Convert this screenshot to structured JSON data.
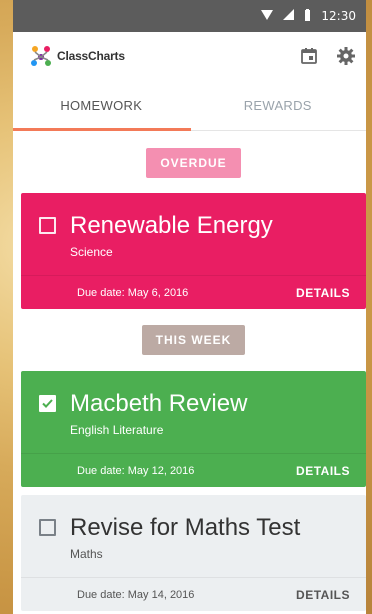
{
  "status_bar": {
    "time": "12:30"
  },
  "app": {
    "logo_text": "ClassCharts"
  },
  "tabs": [
    {
      "label": "HOMEWORK",
      "active": true
    },
    {
      "label": "REWARDS",
      "active": false
    }
  ],
  "sections": {
    "overdue": {
      "label": "OVERDUE"
    },
    "this_week": {
      "label": "THIS WEEK"
    }
  },
  "cards": [
    {
      "title": "Renewable Energy",
      "subject": "Science",
      "due": "Due date: May 6, 2016",
      "details": "DETAILS",
      "checked": false,
      "color": "#e91e63"
    },
    {
      "title": "Macbeth Review",
      "subject": "English Literature",
      "due": "Due date: May 12, 2016",
      "details": "DETAILS",
      "checked": true,
      "color": "#4caf50"
    },
    {
      "title": "Revise for Maths Test",
      "subject": "Maths",
      "due": "Due date: May 14, 2016",
      "details": "DETAILS",
      "checked": false,
      "color": "#eceff1"
    }
  ],
  "colors": {
    "accent": "#f37a58",
    "overdue_pill": "#f48fb1",
    "this_week_pill": "#bcaaa4",
    "status_bar": "#5c5c5c"
  },
  "icons": [
    "wifi-icon",
    "signal-icon",
    "battery-icon",
    "calendar-icon",
    "gear-icon",
    "checkbox-icon"
  ]
}
